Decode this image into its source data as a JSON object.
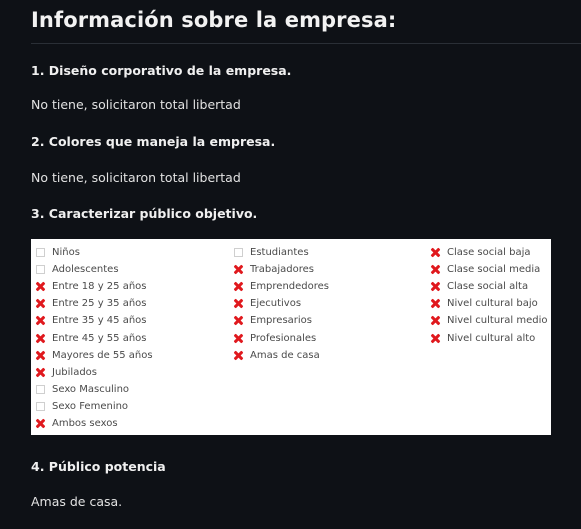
{
  "page": {
    "title": "Información sobre la empresa:"
  },
  "sections": [
    {
      "heading": "1. Diseño corporativo de la empresa.",
      "answer": "No tiene, solicitaron total libertad"
    },
    {
      "heading": "2. Colores que maneja la empresa.",
      "answer": "No tiene, solicitaron total libertad"
    },
    {
      "heading": "3. Caracterizar público objetivo."
    },
    {
      "heading": "4. Público potencia",
      "answer": "Amas de casa."
    }
  ],
  "checklist": {
    "check_color": "#e0191e",
    "columns": [
      [
        {
          "label": "Niños",
          "checked": false
        },
        {
          "label": "Adolescentes",
          "checked": false
        },
        {
          "label": "Entre 18 y 25 años",
          "checked": true
        },
        {
          "label": "Entre 25 y 35 años",
          "checked": true
        },
        {
          "label": "Entre 35 y 45 años",
          "checked": true
        },
        {
          "label": "Entre 45 y 55 años",
          "checked": true
        },
        {
          "label": "Mayores de 55 años",
          "checked": true
        },
        {
          "label": "Jubilados",
          "checked": true
        },
        {
          "label": "Sexo Masculino",
          "checked": false
        },
        {
          "label": "Sexo Femenino",
          "checked": false
        },
        {
          "label": "Ambos sexos",
          "checked": true
        }
      ],
      [
        {
          "label": "Estudiantes",
          "checked": false
        },
        {
          "label": "Trabajadores",
          "checked": true
        },
        {
          "label": "Emprendedores",
          "checked": true
        },
        {
          "label": "Ejecutivos",
          "checked": true
        },
        {
          "label": "Empresarios",
          "checked": true
        },
        {
          "label": "Profesionales",
          "checked": true
        },
        {
          "label": "Amas de casa",
          "checked": true
        }
      ],
      [
        {
          "label": "Clase social baja",
          "checked": true
        },
        {
          "label": "Clase social media",
          "checked": true
        },
        {
          "label": "Clase social alta",
          "checked": true
        },
        {
          "label": "Nivel cultural bajo",
          "checked": true
        },
        {
          "label": "Nivel cultural medio",
          "checked": true
        },
        {
          "label": "Nivel cultural alto",
          "checked": true
        }
      ]
    ]
  }
}
